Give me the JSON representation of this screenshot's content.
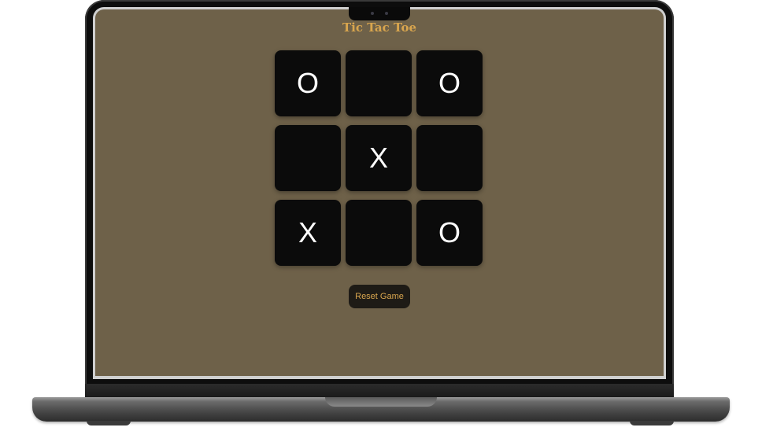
{
  "app": {
    "title": "Tic Tac Toe"
  },
  "board": {
    "cells": [
      "O",
      "",
      "O",
      "",
      "X",
      "",
      "X",
      "",
      "O"
    ]
  },
  "controls": {
    "reset_label": "Reset Game"
  },
  "colors": {
    "background": "#6e6149",
    "cell": "#0b0b0b",
    "accent": "#d8a54e",
    "mark": "#ffffff",
    "button": "#1e1b16"
  }
}
